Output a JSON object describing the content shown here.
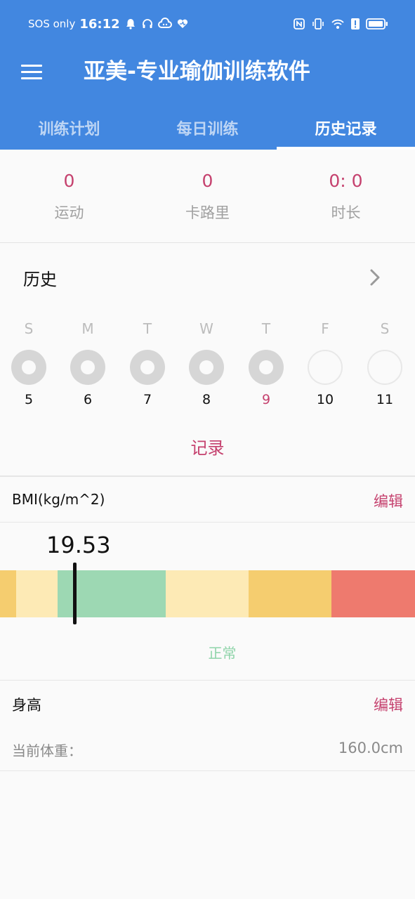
{
  "status_bar": {
    "carrier": "SOS only",
    "time": "16:12",
    "icons_left": [
      "bell-icon",
      "headphones-icon",
      "cloud-icon",
      "heart-icon"
    ],
    "icons_right": [
      "nfc-icon",
      "vibrate-icon",
      "wifi-icon",
      "alert-icon",
      "battery-icon"
    ]
  },
  "app": {
    "title": "亚美-专业瑜伽训练软件"
  },
  "tabs": [
    {
      "label": "训练计划",
      "active": false
    },
    {
      "label": "每日训练",
      "active": false
    },
    {
      "label": "历史记录",
      "active": true
    }
  ],
  "stats": [
    {
      "value": "0",
      "label": "运动"
    },
    {
      "value": "0",
      "label": "卡路里"
    },
    {
      "value": "0: 0",
      "label": "时长"
    }
  ],
  "history": {
    "title": "历史",
    "week": [
      {
        "letter": "S",
        "date": "5",
        "state": "done"
      },
      {
        "letter": "M",
        "date": "6",
        "state": "done"
      },
      {
        "letter": "T",
        "date": "7",
        "state": "done"
      },
      {
        "letter": "W",
        "date": "8",
        "state": "done"
      },
      {
        "letter": "T",
        "date": "9",
        "state": "done",
        "today": true
      },
      {
        "letter": "F",
        "date": "10",
        "state": "empty"
      },
      {
        "letter": "S",
        "date": "11",
        "state": "empty"
      }
    ],
    "record_label": "记录"
  },
  "bmi": {
    "label": "BMI(kg/m^2)",
    "edit_label": "编辑",
    "value": "19.53",
    "status": "正常",
    "colors": {
      "under_severe": "#f5cd6f",
      "under": "#fdeab5",
      "normal": "#9dd8b3",
      "over": "#fdeab5",
      "obese": "#f5cd6f",
      "severe": "#ee7a6e"
    }
  },
  "body": {
    "height_label": "身高",
    "edit_label": "编辑",
    "weight_label": "当前体重：",
    "weight_value": "160.0cm"
  },
  "colors": {
    "primary": "#4287e0",
    "accent": "#c5416e"
  }
}
